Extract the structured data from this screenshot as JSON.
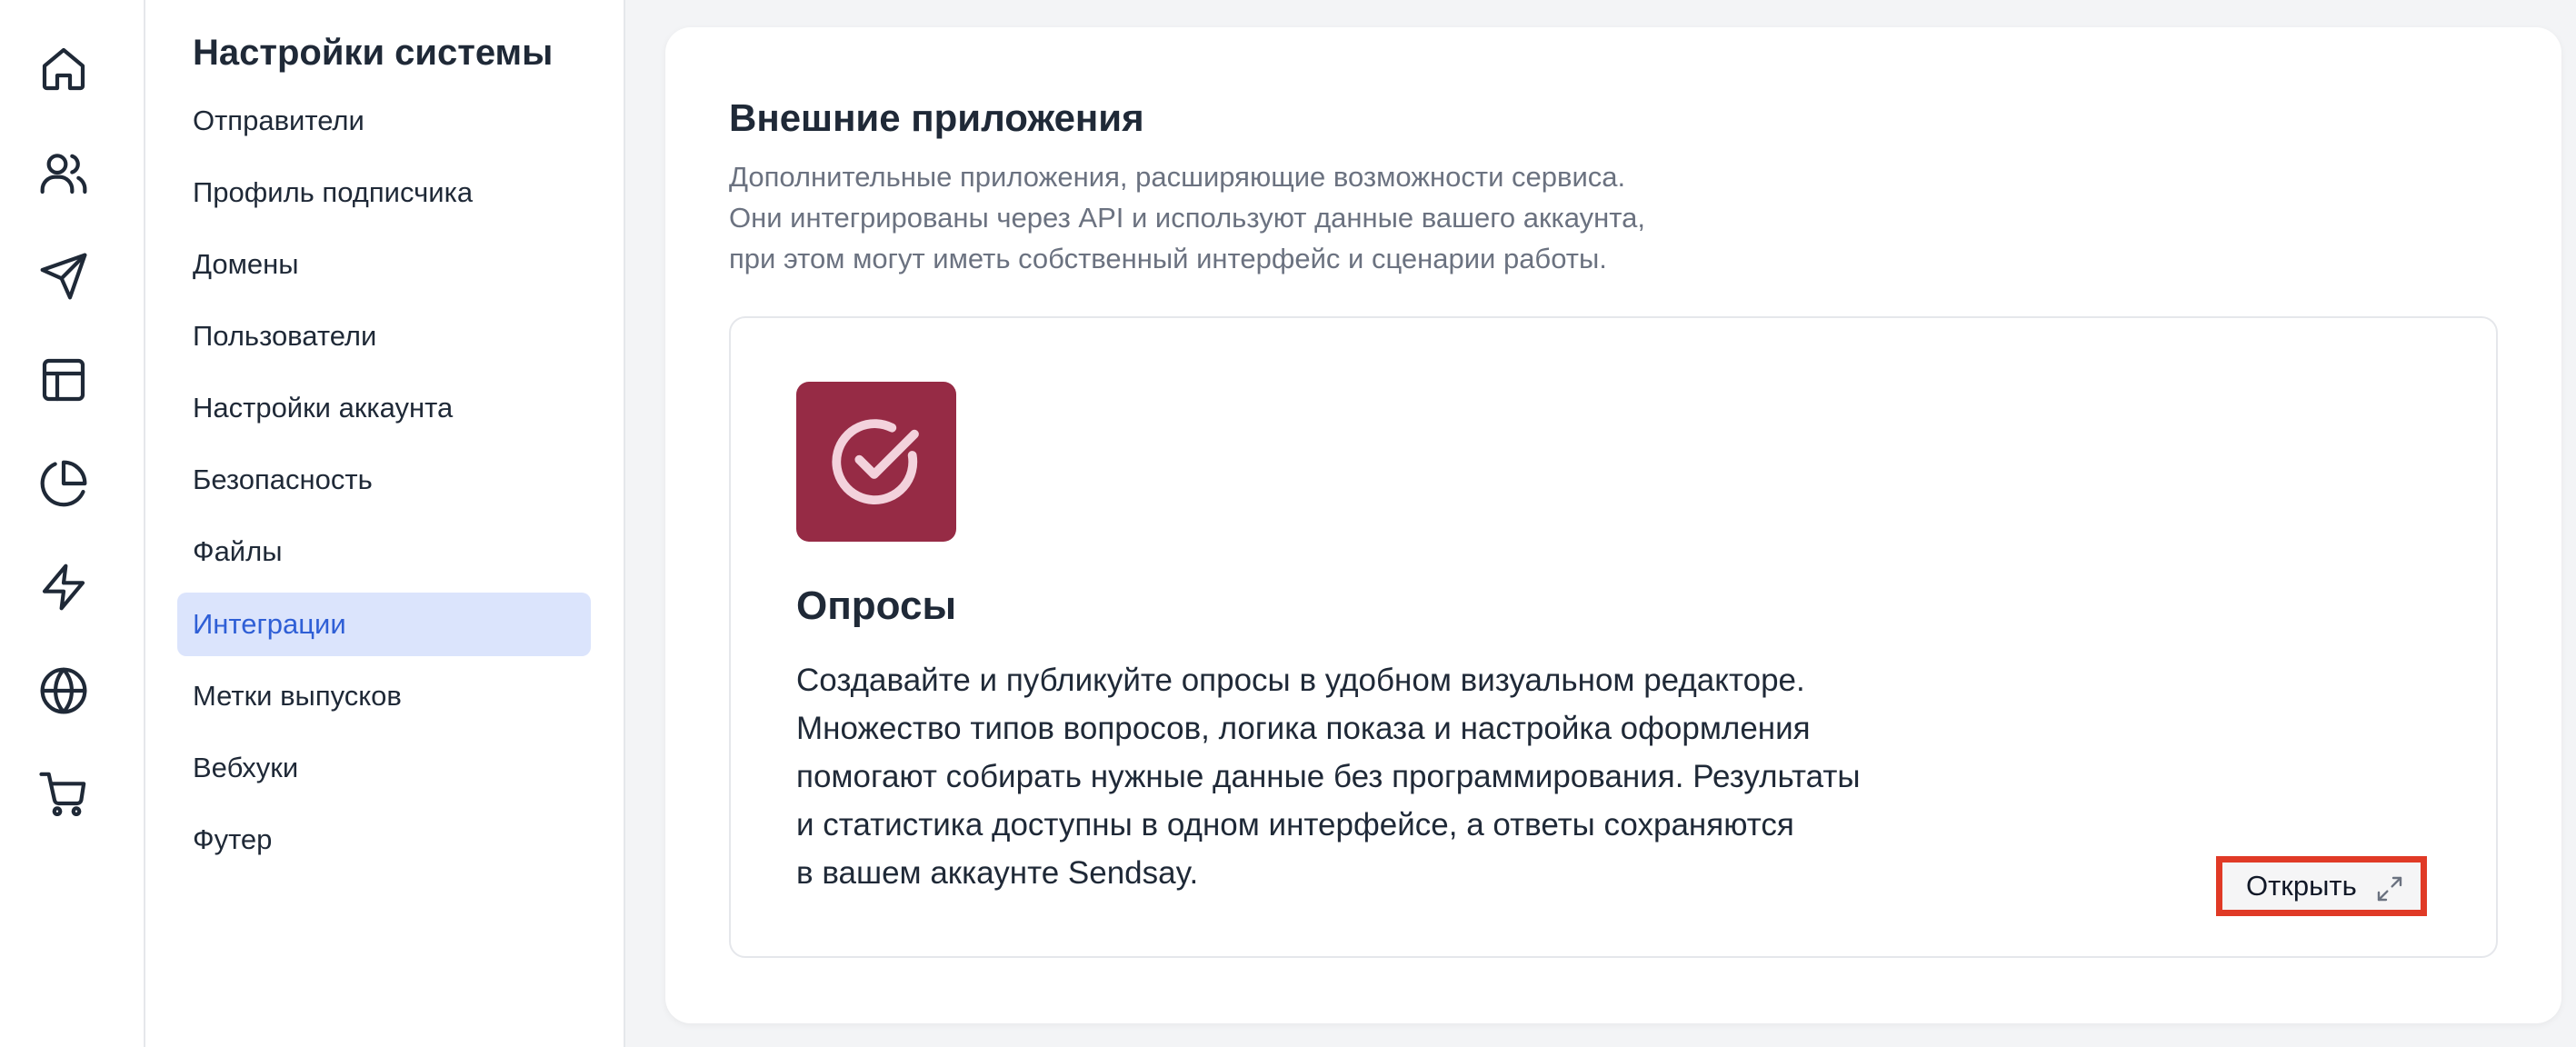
{
  "rail": {
    "icons": [
      "home-icon",
      "users-icon",
      "send-icon",
      "layout-icon",
      "pie-chart-icon",
      "zap-icon",
      "globe-icon",
      "cart-icon"
    ]
  },
  "sidebar": {
    "title": "Настройки системы",
    "items": [
      {
        "label": "Отправители"
      },
      {
        "label": "Профиль подписчика"
      },
      {
        "label": "Домены"
      },
      {
        "label": "Пользователи"
      },
      {
        "label": "Настройки аккаунта"
      },
      {
        "label": "Безопасность"
      },
      {
        "label": "Файлы"
      },
      {
        "label": "Интеграции",
        "active": true
      },
      {
        "label": "Метки выпусков"
      },
      {
        "label": "Вебхуки"
      },
      {
        "label": "Футер"
      }
    ]
  },
  "main": {
    "title": "Внешние приложения",
    "description": [
      "Дополнительные приложения, расширяющие возможности сервиса.",
      "Они интегрированы через API и используют данные вашего аккаунта,",
      "при этом могут иметь собственный интерфейс и сценарии работы."
    ],
    "app": {
      "icon": "check-circle-icon",
      "name": "Опросы",
      "description": [
        "Создавайте и публикуйте опросы в удобном визуальном редакторе.",
        "Множество типов вопросов, логика показа и настройка оформления",
        "помогают собирать нужные данные без программирования. Результаты",
        "и статистика доступны в одном интерфейсе, а ответы сохраняются",
        "в вашем аккаунте Sendsay."
      ],
      "open_label": "Открыть",
      "open_icon": "external-expand-icon"
    }
  },
  "colors": {
    "accent": "#2f5fd6",
    "active_bg": "#dbe4fc",
    "app_logo_bg": "#962b45",
    "highlight_border": "#e03a26"
  }
}
